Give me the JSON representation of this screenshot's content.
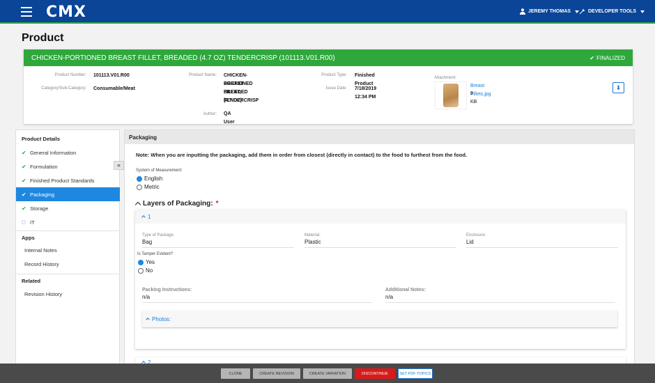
{
  "app": {
    "logo_text": "CMX",
    "user_name": "JEREMY THOMAS",
    "dev_tools": "DEVELOPER TOOLS"
  },
  "page": {
    "title": "Product"
  },
  "header": {
    "product_title": "CHICKEN-PORTIONED BREAST FILLET, BREADED (4.7 OZ) TENDERCRISP (101113.V01.R00)",
    "status": "FINALIZED",
    "product_number_label": "Product Number:",
    "product_number": "101113.V01.R00",
    "category_label": "Category/Sub-Category:",
    "category": "Consumable/Meat",
    "product_name_label": "Product Name:",
    "product_name_lines": [
      "CHICKEN-PORTIONED",
      "BREAST FILLET,",
      "BREADED (4.7 OZ)",
      "TENDERCRISP"
    ],
    "author_label": "Author:",
    "author": "QA User",
    "product_type_label": "Product Type:",
    "product_type": "Finished Product",
    "issue_date_label": "Issue Date:",
    "issue_date": "7/18/2019 12:34 PM",
    "attachment_label": "Attachment:",
    "attachment_name": "Breast Fillets.jpg",
    "attachment_size": "9 KB"
  },
  "sidebar": {
    "details_title": "Product Details",
    "items": [
      {
        "label": "General Information",
        "state": "done"
      },
      {
        "label": "Formulation",
        "state": "done"
      },
      {
        "label": "Finished Product Standards",
        "state": "done"
      },
      {
        "label": "Packaging",
        "state": "active"
      },
      {
        "label": "Storage",
        "state": "done"
      },
      {
        "label": "IT",
        "state": "empty"
      }
    ],
    "apps_title": "Apps",
    "apps": [
      "Internal Notes",
      "Record History"
    ],
    "related_title": "Related",
    "related": [
      "Revision History"
    ]
  },
  "main": {
    "section_title": "Packaging",
    "note": "Note: When you are inputting the packaging, add them in order from closest (directly in contact) to the food to furthest from the food.",
    "measurement_label": "System of Measurement:",
    "measurement_options": [
      "English",
      "Metric"
    ],
    "measurement_selected": "English",
    "layers_title": "Layers of Packaging:",
    "layer1": {
      "index": "1",
      "type_label": "Type of Package:",
      "type_value": "Bag",
      "material_label": "Material:",
      "material_value": "Plastic",
      "enclosure_label": "Enclosure:",
      "enclosure_value": "Lid",
      "tamper_label": "Is Tamper Evident?",
      "tamper_options": [
        "Yes",
        "No"
      ],
      "tamper_selected": "Yes",
      "instructions_label": "Packing Instructions:",
      "instructions_value": "n/a",
      "notes_label": "Additional Notes:",
      "notes_value": "n/a",
      "photos_label": "Photos:"
    },
    "layer2_index": "2"
  },
  "footer": {
    "clone": "CLONE",
    "create_revision": "CREATE REVISION",
    "create_variation": "CREATE VARIATION",
    "discontinue": "DISCONTINUE",
    "set_pdf_topics": "SET PDF TOPICS"
  },
  "colors": {
    "brand_blue": "#0a4597",
    "success_green": "#2ea83c",
    "accent_blue": "#1e87e0",
    "danger_red": "#d91a1a"
  }
}
